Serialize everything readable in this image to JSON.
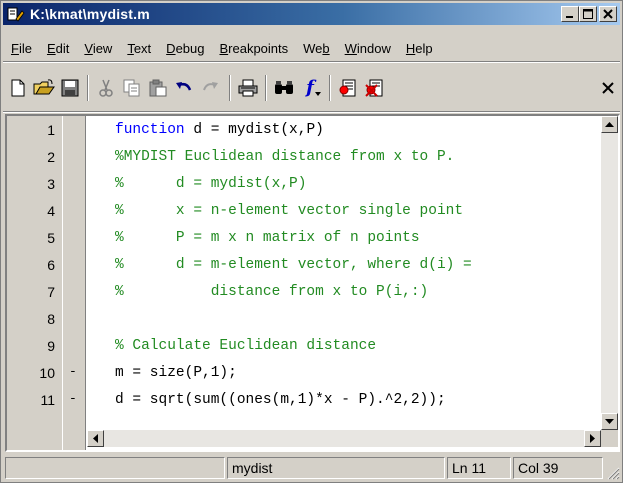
{
  "window": {
    "title": "K:\\kmat\\mydist.m",
    "minimize_icon": "minimize-icon",
    "maximize_icon": "maximize-icon",
    "close_icon": "close-icon"
  },
  "menu": [
    {
      "label": "File",
      "underline": "F"
    },
    {
      "label": "Edit",
      "underline": "E"
    },
    {
      "label": "View",
      "underline": "V"
    },
    {
      "label": "Text",
      "underline": "T"
    },
    {
      "label": "Debug",
      "underline": "D"
    },
    {
      "label": "Breakpoints",
      "underline": "B"
    },
    {
      "label": "Web",
      "underline": "b"
    },
    {
      "label": "Window",
      "underline": "W"
    },
    {
      "label": "Help",
      "underline": "H"
    }
  ],
  "toolbar": [
    {
      "name": "new-file-icon"
    },
    {
      "name": "open-file-icon"
    },
    {
      "name": "save-icon"
    },
    {
      "name": "cut-icon"
    },
    {
      "name": "copy-icon"
    },
    {
      "name": "paste-icon"
    },
    {
      "name": "undo-icon"
    },
    {
      "name": "redo-icon"
    },
    {
      "name": "print-icon"
    },
    {
      "name": "find-icon"
    },
    {
      "name": "function-icon",
      "glyph": "f"
    },
    {
      "name": "set-breakpoint-icon"
    },
    {
      "name": "clear-breakpoint-icon"
    },
    {
      "name": "close-toolbar-icon"
    }
  ],
  "code_lines": [
    {
      "n": "1",
      "dash": "",
      "parts": [
        {
          "t": "function",
          "c": "kw"
        },
        {
          "t": " d = mydist(x,P)",
          "c": "tx"
        }
      ]
    },
    {
      "n": "2",
      "dash": "",
      "parts": [
        {
          "t": "%MYDIST Euclidean distance from x to P.",
          "c": "cm"
        }
      ]
    },
    {
      "n": "3",
      "dash": "",
      "parts": [
        {
          "t": "%      d = mydist(x,P)",
          "c": "cm"
        }
      ]
    },
    {
      "n": "4",
      "dash": "",
      "parts": [
        {
          "t": "%      x = n-element vector single point",
          "c": "cm"
        }
      ]
    },
    {
      "n": "5",
      "dash": "",
      "parts": [
        {
          "t": "%      P = m x n matrix of n points",
          "c": "cm"
        }
      ]
    },
    {
      "n": "6",
      "dash": "",
      "parts": [
        {
          "t": "%      d = m-element vector, where d(i) =",
          "c": "cm"
        }
      ]
    },
    {
      "n": "7",
      "dash": "",
      "parts": [
        {
          "t": "%          distance from x to P(i,:)",
          "c": "cm"
        }
      ]
    },
    {
      "n": "8",
      "dash": "",
      "parts": []
    },
    {
      "n": "9",
      "dash": "",
      "parts": [
        {
          "t": "% Calculate Euclidean distance",
          "c": "cm"
        }
      ]
    },
    {
      "n": "10",
      "dash": "-",
      "parts": [
        {
          "t": "m = size(P,1);",
          "c": "tx"
        }
      ]
    },
    {
      "n": "11",
      "dash": "-",
      "parts": [
        {
          "t": "d = sqrt(sum((ones(m,1)*x - P).^2,2));",
          "c": "tx"
        }
      ]
    }
  ],
  "status": {
    "function_name": "mydist",
    "line": "Ln 11",
    "column": "Col 39"
  },
  "colors": {
    "keyword": "#0000ff",
    "comment": "#228b22",
    "title_bar_start": "#0a246a",
    "title_bar_end": "#a6caf0"
  }
}
